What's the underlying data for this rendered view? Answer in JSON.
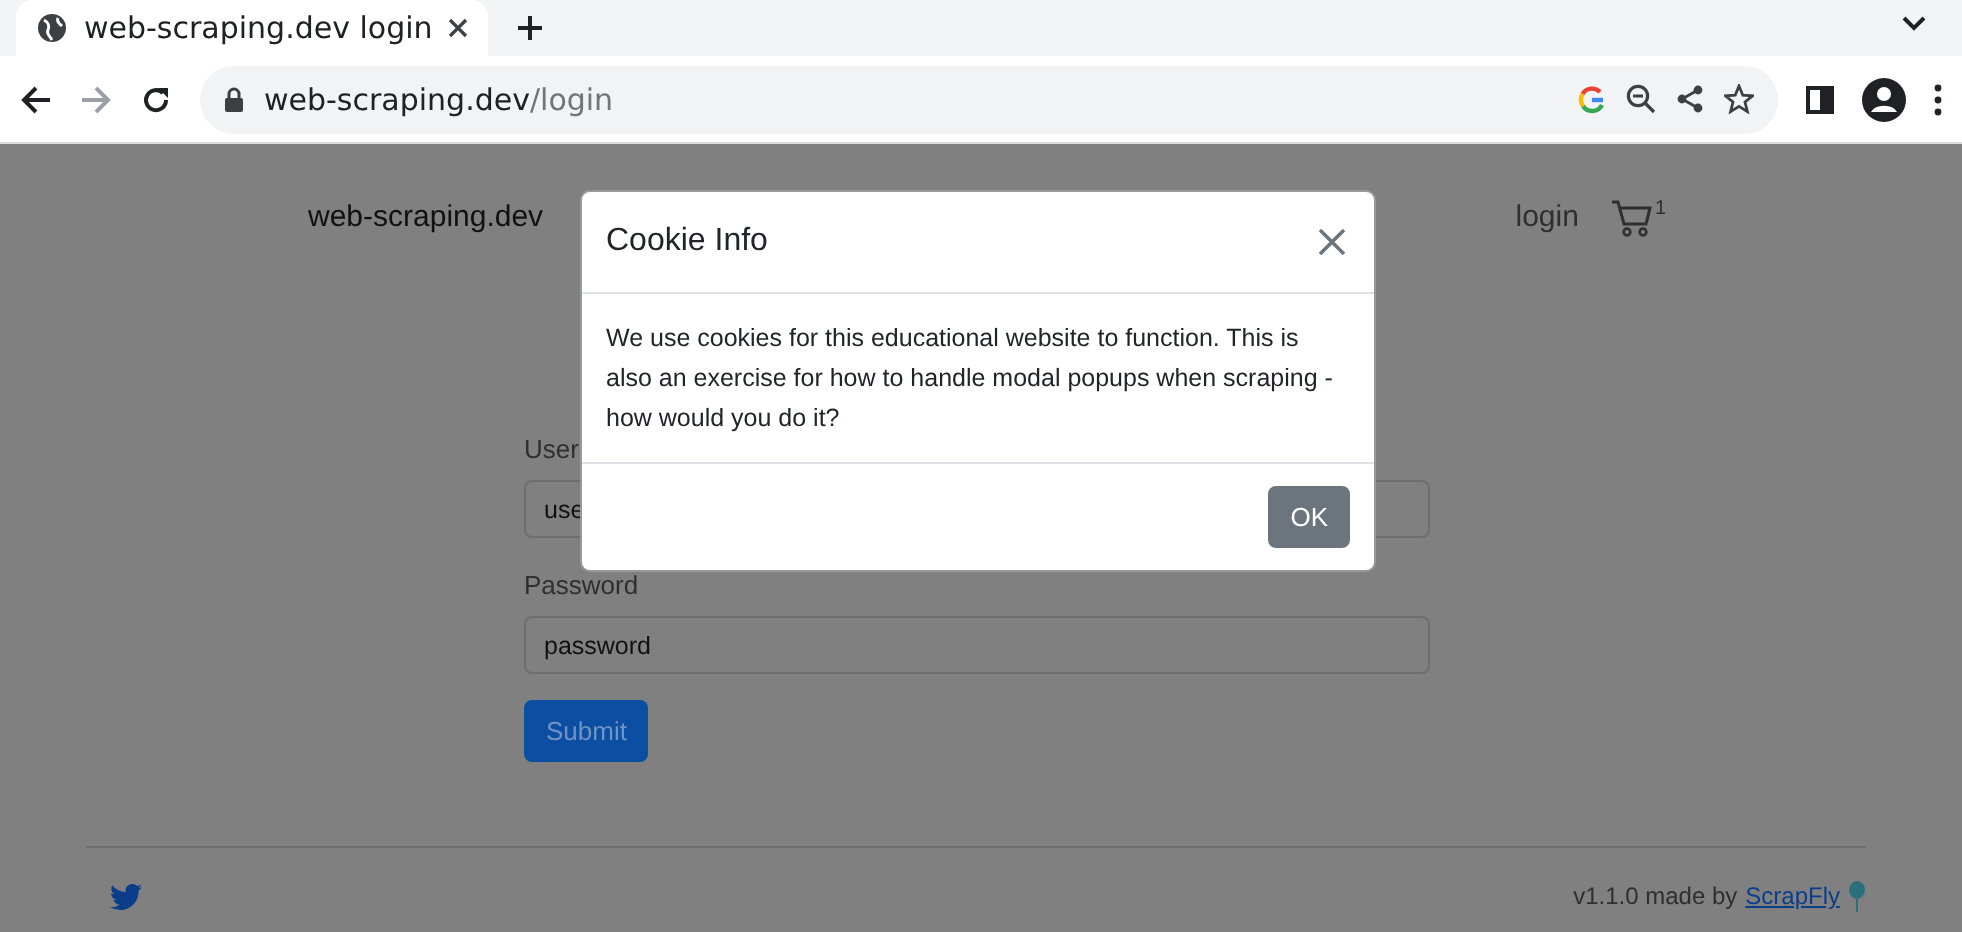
{
  "browser": {
    "tab_title": "web-scraping.dev login",
    "url_host": "web-scraping.dev",
    "url_path": "/login"
  },
  "navbar": {
    "brand": "web-scraping.dev",
    "login": "login",
    "cart_count": "1"
  },
  "form": {
    "fields": [
      {
        "label": "User",
        "value": "use"
      },
      {
        "label": "Password",
        "value": "password"
      }
    ],
    "submit": "Submit"
  },
  "footer": {
    "text": "v1.1.0 made by",
    "link": "ScrapFly"
  },
  "modal": {
    "title": "Cookie Info",
    "body": "We use cookies for this educational website to function. This is also an exercise for how to handle modal popups when scraping - how would you do it?",
    "button": "OK"
  }
}
